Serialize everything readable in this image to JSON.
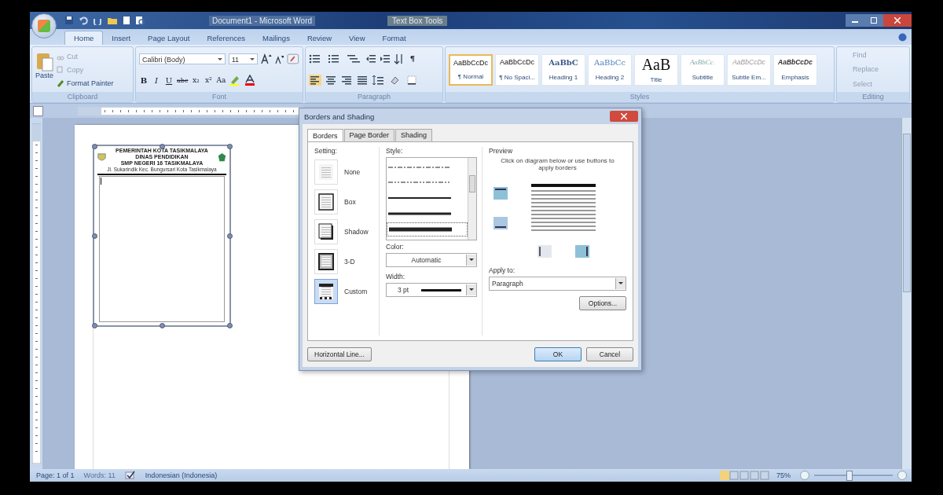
{
  "window": {
    "title": "Document1 - Microsoft Word",
    "context_label": "Text Box Tools"
  },
  "ribbon_tabs": [
    {
      "label": "Home",
      "selected": true
    },
    {
      "label": "Insert",
      "selected": false
    },
    {
      "label": "Page Layout",
      "selected": false
    },
    {
      "label": "References",
      "selected": false
    },
    {
      "label": "Mailings",
      "selected": false
    },
    {
      "label": "Review",
      "selected": false
    },
    {
      "label": "View",
      "selected": false
    },
    {
      "label": "Format",
      "selected": false
    }
  ],
  "clipboard": {
    "paste": "Paste",
    "cut": "Cut",
    "copy": "Copy",
    "format_painter": "Format Painter",
    "group": "Clipboard"
  },
  "font": {
    "name": "Calibri (Body)",
    "size": "11",
    "buttons": [
      "B",
      "I",
      "U",
      "abc",
      "x₂",
      "x²",
      "Aa"
    ],
    "group": "Font"
  },
  "paragraph": {
    "marks": "¶",
    "group": "Paragraph"
  },
  "styles": {
    "group": "Styles",
    "items": [
      {
        "sample": "AaBbCcDc",
        "name": "¶ Normal",
        "kind": "normal",
        "selected": true
      },
      {
        "sample": "AaBbCcDc",
        "name": "¶ No Spaci...",
        "kind": "plain",
        "selected": false
      },
      {
        "sample": "AaBbC",
        "name": "Heading 1",
        "kind": "heading1",
        "selected": false
      },
      {
        "sample": "AaBbCc",
        "name": "Heading 2",
        "kind": "heading2",
        "selected": false
      },
      {
        "sample": "AaB",
        "name": "Title",
        "kind": "title",
        "selected": false
      },
      {
        "sample": "AaBbCc.",
        "name": "Subtitle",
        "kind": "subtitle",
        "selected": false
      },
      {
        "sample": "AaBbCcDc",
        "name": "Subtle Em...",
        "kind": "subtle",
        "selected": false
      },
      {
        "sample": "AaBbCcDc",
        "name": "Emphasis",
        "kind": "emphasis",
        "selected": false
      }
    ]
  },
  "editing": {
    "find": "Find",
    "replace": "Replace",
    "select": "Select",
    "group": "Editing"
  },
  "document": {
    "letterhead": [
      "PEMERINTAH KOTA TASIKMALAYA",
      "DINAS PENDIDIKAN",
      "SMP NEGERI 16 TASIKMALAYA"
    ],
    "address": "Jl. Sukarindik Kec. Bungursari Kota Tasikmalaya"
  },
  "dialog": {
    "title": "Borders and Shading",
    "tabs": [
      {
        "label": "Borders",
        "selected": true
      },
      {
        "label": "Page Border",
        "selected": false
      },
      {
        "label": "Shading",
        "selected": false
      }
    ],
    "setting_label": "Setting:",
    "settings": [
      {
        "label": "None",
        "kind": "none",
        "selected": false
      },
      {
        "label": "Box",
        "kind": "box",
        "selected": false
      },
      {
        "label": "Shadow",
        "kind": "shadow",
        "selected": false
      },
      {
        "label": "3-D",
        "kind": "threed",
        "selected": false
      },
      {
        "label": "Custom",
        "kind": "custom",
        "selected": true
      }
    ],
    "style_label": "Style:",
    "line_styles": [
      {
        "kind": "dashdot",
        "selected": false
      },
      {
        "kind": "dashdotdot",
        "selected": false
      },
      {
        "kind": "thin",
        "selected": false
      },
      {
        "kind": "medium",
        "selected": false
      },
      {
        "kind": "thick",
        "selected": true
      }
    ],
    "color_label": "Color:",
    "color_value": "Automatic",
    "width_label": "Width:",
    "width_value": "3 pt",
    "preview_label": "Preview",
    "preview_hint": "Click on diagram below or use buttons to apply borders",
    "apply_label": "Apply to:",
    "apply_value": "Paragraph",
    "options": "Options...",
    "horizontal_line": "Horizontal Line...",
    "ok": "OK",
    "cancel": "Cancel"
  },
  "status_bar": {
    "page": "Page: 1 of 1",
    "words": "Words: 11",
    "language": "Indonesian (Indonesia)",
    "zoom": "75%",
    "zoom_slider": {
      "level": 0.45
    }
  }
}
